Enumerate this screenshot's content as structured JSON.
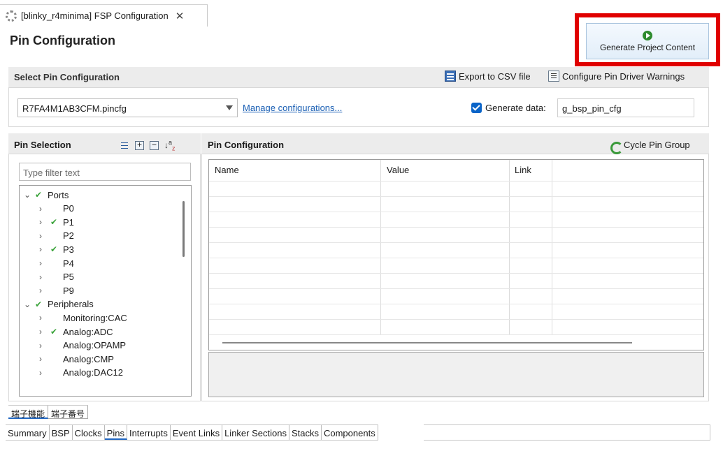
{
  "editor_tab": {
    "title": "[blinky_r4minima] FSP Configuration",
    "icon": "gear-icon",
    "close_glyph": "✕"
  },
  "window_controls": "▭ ▭",
  "page_title": "Pin Configuration",
  "generate_button": {
    "label": "Generate Project Content",
    "icon": "play-icon",
    "highlight_color": "#e00000"
  },
  "select_section": {
    "title": "Select Pin Configuration",
    "export_label": "Export to CSV file",
    "configure_warnings_label": "Configure Pin Driver Warnings",
    "selected_config": "R7FA4M1AB3CFM.pincfg",
    "manage_link": "Manage configurations...",
    "generate_data_checked": true,
    "generate_data_label": "Generate data:",
    "generate_data_value": "g_bsp_pin_cfg"
  },
  "pin_selection": {
    "title": "Pin Selection",
    "filter_placeholder": "Type filter text",
    "tree": [
      {
        "label": "Ports",
        "level": 0,
        "expanded": true,
        "checked": true
      },
      {
        "label": "P0",
        "level": 1,
        "checked": false
      },
      {
        "label": "P1",
        "level": 1,
        "checked": true
      },
      {
        "label": "P2",
        "level": 1,
        "checked": false
      },
      {
        "label": "P3",
        "level": 1,
        "checked": true
      },
      {
        "label": "P4",
        "level": 1,
        "checked": false
      },
      {
        "label": "P5",
        "level": 1,
        "checked": false
      },
      {
        "label": "P9",
        "level": 1,
        "checked": false
      },
      {
        "label": "Peripherals",
        "level": 0,
        "expanded": true,
        "checked": true
      },
      {
        "label": "Monitoring:CAC",
        "level": 1,
        "checked": false
      },
      {
        "label": "Analog:ADC",
        "level": 1,
        "checked": true
      },
      {
        "label": "Analog:OPAMP",
        "level": 1,
        "checked": false
      },
      {
        "label": "Analog:CMP",
        "level": 1,
        "checked": false
      },
      {
        "label": "Analog:DAC12",
        "level": 1,
        "checked": false
      }
    ]
  },
  "pin_configuration": {
    "title": "Pin Configuration",
    "cycle_label": "Cycle Pin Group",
    "columns": [
      "Name",
      "Value",
      "Link"
    ]
  },
  "japanese_tabs": [
    "端子機能",
    "端子番号"
  ],
  "bottom_tabs": [
    "Summary",
    "BSP",
    "Clocks",
    "Pins",
    "Interrupts",
    "Event Links",
    "Linker Sections",
    "Stacks",
    "Components"
  ],
  "bottom_tabs_selected": "Pins",
  "colors": {
    "accent": "#1f66c2",
    "check": "#3aa33a",
    "link": "#1a5fb4"
  }
}
